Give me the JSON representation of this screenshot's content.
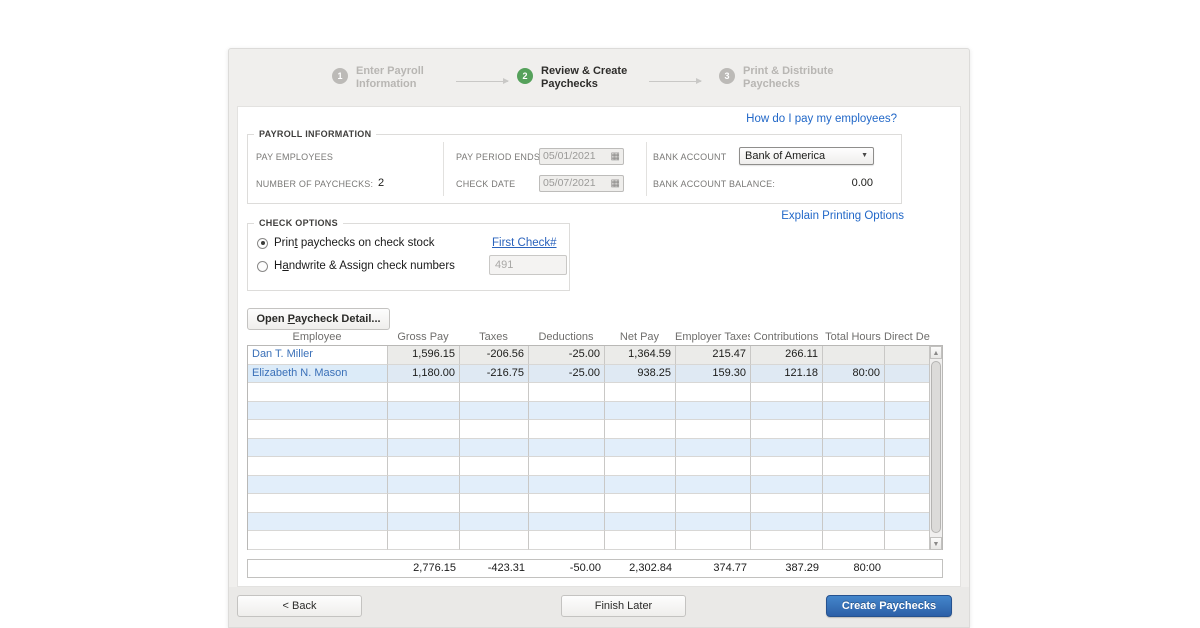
{
  "stepper": {
    "steps": [
      {
        "number": "1",
        "label": "Enter Payroll\nInformation",
        "active": false
      },
      {
        "number": "2",
        "label": "Review & Create\nPaychecks",
        "active": true
      },
      {
        "number": "3",
        "label": "Print & Distribute\nPaychecks",
        "active": false
      }
    ]
  },
  "links": {
    "help": "How do I pay my employees?",
    "printing": "Explain Printing Options"
  },
  "payroll_info": {
    "legend": "PAYROLL INFORMATION",
    "pay_employees_label": "PAY EMPLOYEES",
    "num_paychecks_label": "NUMBER OF PAYCHECKS:",
    "num_paychecks_value": "2",
    "pay_period_label": "PAY PERIOD ENDS",
    "pay_period_value": "05/01/2021",
    "check_date_label": "CHECK DATE",
    "check_date_value": "05/07/2021",
    "bank_account_label": "BANK ACCOUNT",
    "bank_account_value": "Bank of America",
    "bank_balance_label": "BANK ACCOUNT BALANCE:",
    "bank_balance_value": "0.00",
    "calendar_icon": "▦",
    "dropdown_arrow": "▼"
  },
  "check_options": {
    "legend": "CHECK OPTIONS",
    "radio_print": {
      "pre": "Prin",
      "key": "t",
      "post": " paychecks on check stock"
    },
    "radio_handwrite": {
      "pre": "H",
      "key": "a",
      "post": "ndwrite & Assign check numbers"
    },
    "first_check_label": "First Check#",
    "first_check_value": "491"
  },
  "buttons": {
    "open_detail": {
      "pre": "Open ",
      "key": "P",
      "post": "aycheck Detail..."
    },
    "back": "< Back",
    "finish_later": "Finish Later",
    "create": "Create Paychecks"
  },
  "table": {
    "columns": [
      "Employee",
      "Gross Pay",
      "Taxes",
      "Deductions",
      "Net Pay",
      "Employer Taxes",
      "Contributions",
      "Total Hours",
      "Direct Dep"
    ],
    "rows": [
      {
        "employee": "Dan T. Miller",
        "values": [
          "1,596.15",
          "-206.56",
          "-25.00",
          "1,364.59",
          "215.47",
          "266.11",
          "",
          ""
        ]
      },
      {
        "employee": "Elizabeth N. Mason",
        "values": [
          "1,180.00",
          "-216.75",
          "-25.00",
          "938.25",
          "159.30",
          "121.18",
          "80:00",
          ""
        ]
      }
    ],
    "empty_rows": 9,
    "totals": [
      "2,776.15",
      "-423.31",
      "-50.00",
      "2,302.84",
      "374.77",
      "387.29",
      "80:00",
      ""
    ]
  },
  "scrollbar": {
    "up": "▲",
    "down": "▼"
  },
  "colors": {
    "accent_green": "#55a15b",
    "link_blue": "#2268c8",
    "primary_button_blue": "#2c5fa7",
    "row_alt_blue": "#e2eefa"
  }
}
